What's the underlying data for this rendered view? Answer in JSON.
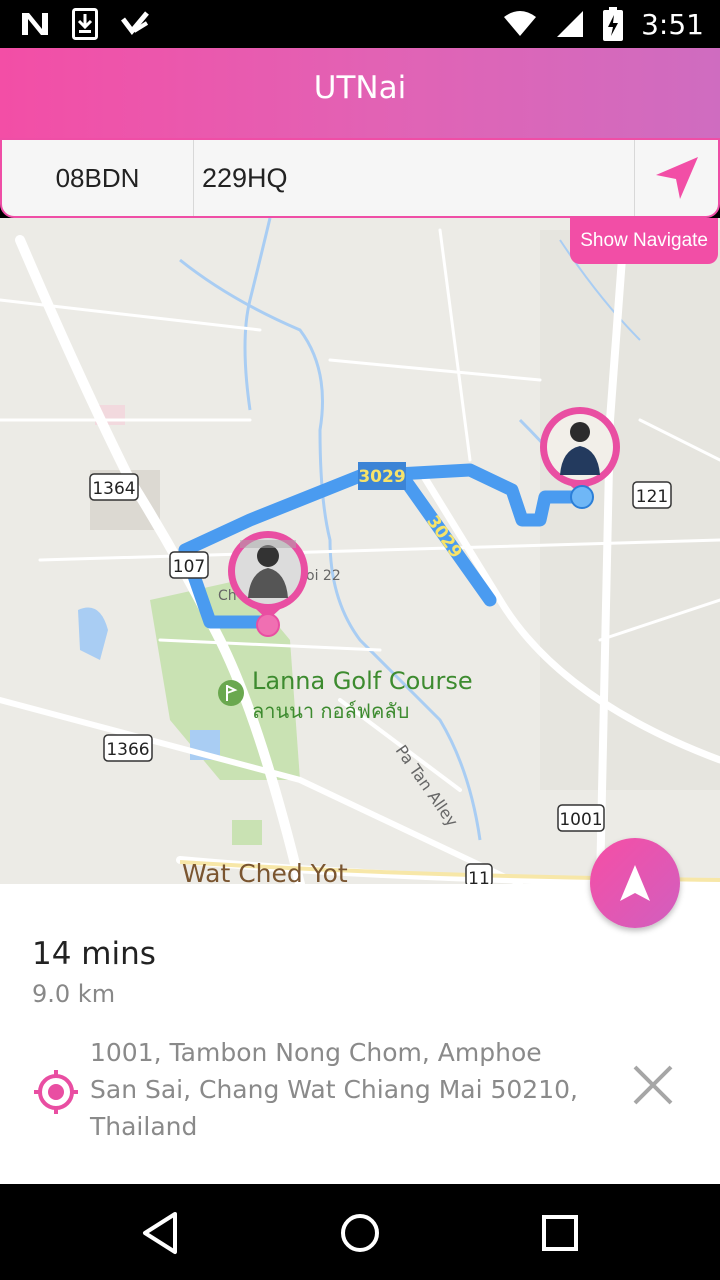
{
  "status_bar": {
    "time": "3:51",
    "left_icons": [
      "n-logo-icon",
      "download-icon",
      "check-badge-icon"
    ],
    "right_icons": [
      "wifi-icon",
      "signal-icon",
      "battery-icon"
    ]
  },
  "app": {
    "title": "UTNai"
  },
  "route": {
    "from": "08BDN",
    "to": "229HQ",
    "go_icon": "send-arrow-icon",
    "show_navigate_label": "Show Navigate"
  },
  "map": {
    "labels": {
      "road_1364": "1364",
      "road_107": "107",
      "road_3029_a": "3029",
      "road_3029_b": "3029",
      "road_121": "121",
      "road_1366": "1366",
      "road_1001": "1001",
      "road_11": "11",
      "soi_partial_left": "Ch",
      "soi_partial_right": "oi 22",
      "golf_name": "Lanna Golf Course",
      "golf_name_thai": "ลานนา กอล์ฟคลับ",
      "alley": "Pa Tan Alley",
      "temple": "Wat Ched Yot"
    },
    "colors": {
      "route": "#4a9bf0",
      "marker_ring": "#e94ea2",
      "land": "#ecebe6",
      "park": "#c9e2b3",
      "water": "#a9cdf3"
    }
  },
  "trip": {
    "duration": "14 mins",
    "distance": "9.0 km",
    "address": "1001, Tambon Nong Chom, Amphoe San Sai, Chang Wat Chiang Mai 50210, Thailand",
    "location_icon": "target-location-icon",
    "close_icon": "close-icon"
  },
  "fab": {
    "icon": "navigation-arrow-icon"
  },
  "nav_bar": {
    "icons": [
      "back-icon",
      "home-icon",
      "recents-icon"
    ]
  },
  "accent": "#f24ea6"
}
